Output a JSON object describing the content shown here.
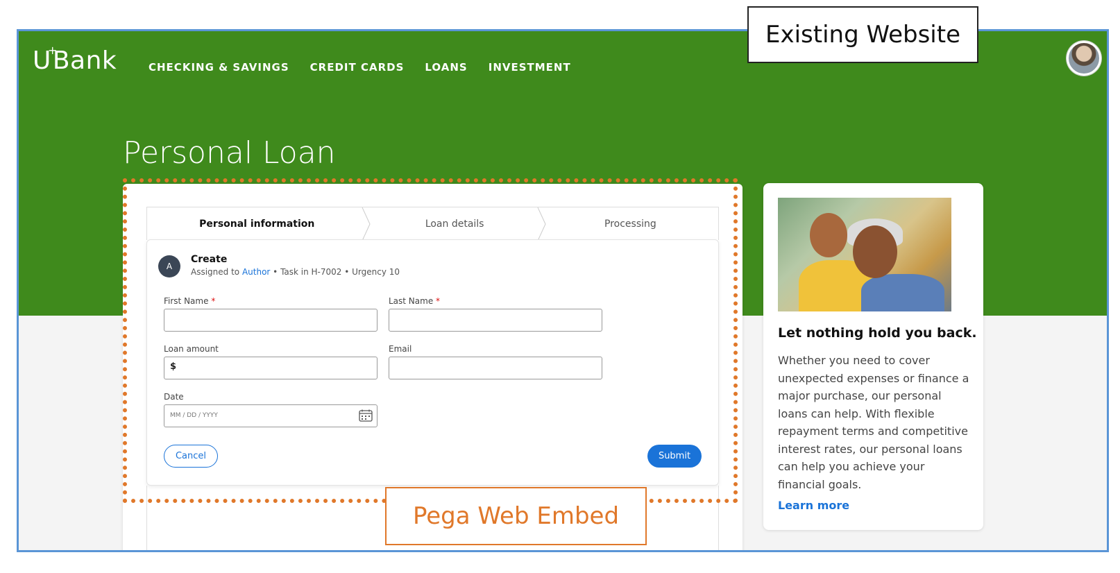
{
  "annotations": {
    "existing_website": "Existing Website",
    "pega_web_embed": "Pega Web Embed"
  },
  "header": {
    "logo": "Bank",
    "nav": [
      "CHECKING & SAVINGS",
      "CREDIT CARDS",
      "LOANS",
      "INVESTMENT"
    ]
  },
  "page_title": "Personal Loan",
  "stepper": [
    "Personal information",
    "Loan details",
    "Processing"
  ],
  "task": {
    "avatar_letter": "A",
    "title": "Create",
    "assigned_prefix": "Assigned to ",
    "assigned_link": "Author",
    "assigned_suffix": " • Task in H-7002 • Urgency 10"
  },
  "form": {
    "first_name_label": "First Name",
    "last_name_label": "Last Name",
    "required_mark": "*",
    "loan_amount_label": "Loan amount",
    "loan_amount_value": "$",
    "email_label": "Email",
    "date_label": "Date",
    "date_placeholder": "MM / DD / YYYY",
    "cancel": "Cancel",
    "submit": "Submit"
  },
  "side_card": {
    "title": "Let nothing hold you back.",
    "body": "Whether you need to cover unexpected expenses or finance a major purchase, our personal loans can help. With flexible repayment terms and competitive interest rates, our personal loans can help you achieve your financial goals.",
    "link": "Learn more"
  },
  "colors": {
    "brand_green": "#3f8a1c",
    "accent_blue": "#1a73d8",
    "embed_orange": "#e0782a",
    "frame_blue": "#5a95d6"
  }
}
